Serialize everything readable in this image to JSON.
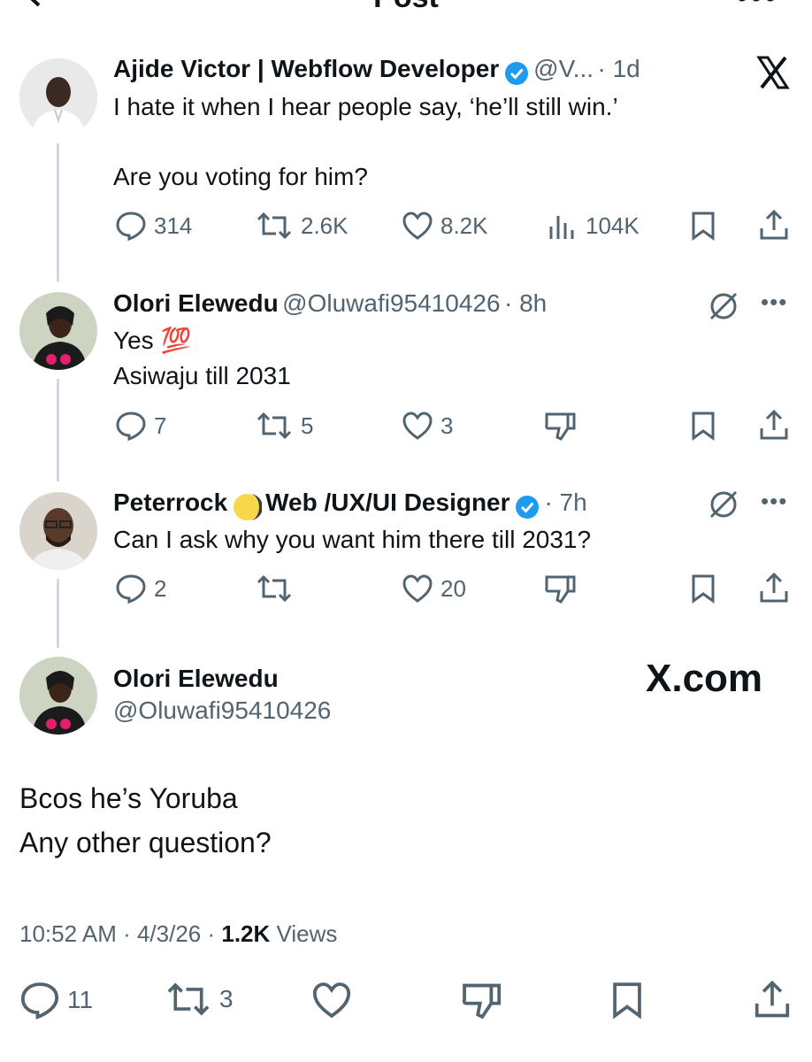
{
  "header": {
    "title": "Post"
  },
  "tweets": [
    {
      "name": "Ajide Victor | Webflow Developer",
      "handle": "@V...",
      "time": "· 1d",
      "line1": "I hate it when I hear people say, ‘he’ll still win.’",
      "line2": "Are you voting for him?",
      "replies": "314",
      "reposts": "2.6K",
      "likes": "8.2K",
      "views": "104K"
    },
    {
      "name": "Olori Elewedu",
      "handle": "@Oluwafi95410426",
      "time": "· 8h",
      "line1": "Yes 💯",
      "line2": "Asiwaju till 2031",
      "replies": "7",
      "reposts": "5",
      "likes": "3"
    },
    {
      "name": "Peterrock",
      "name_suffix": "Web /UX/UI Designer",
      "time": "· 7h",
      "line1": "Can I ask why you want him there till 2031?",
      "replies": "2",
      "reposts": "",
      "likes": "20"
    }
  ],
  "main": {
    "name": "Olori Elewedu",
    "handle": "@Oluwafi95410426",
    "watermark": "X.com",
    "line1": "Bcos he’s Yoruba",
    "line2": "Any other question?",
    "time": "10:52 AM · 4/3/26 ·",
    "views_count": "1.2K",
    "views_label": "Views",
    "replies": "11",
    "reposts": "3"
  },
  "colors": {
    "verified": "#1d9bf0",
    "muted": "#536471",
    "line": "#cfd9de"
  }
}
